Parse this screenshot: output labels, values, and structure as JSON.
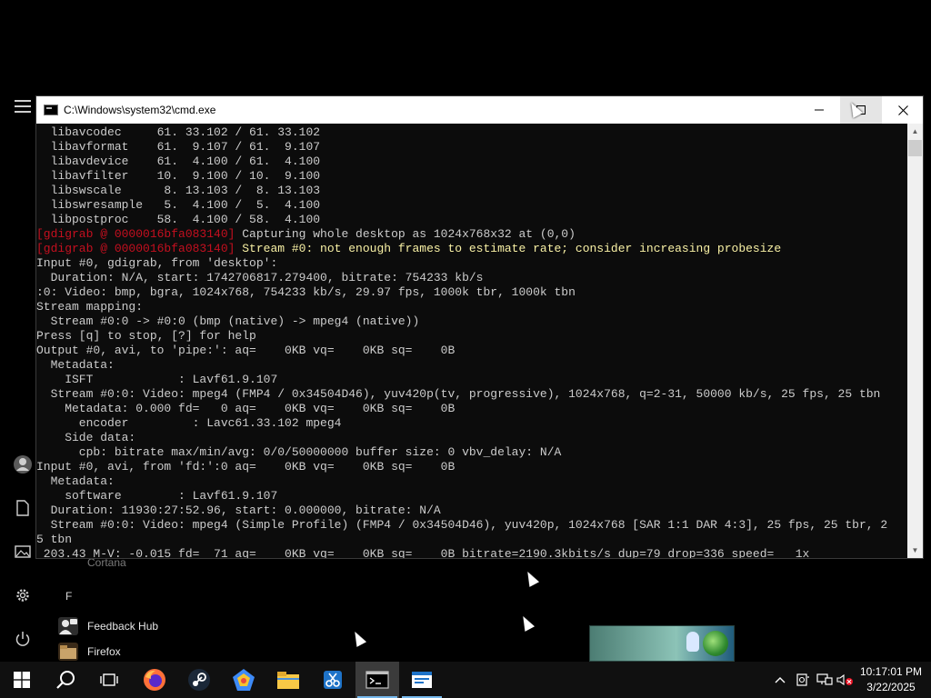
{
  "window": {
    "title": "C:\\Windows\\system32\\cmd.exe",
    "minimize_glyph": "—",
    "maximize_glyph": "☐",
    "close_glyph": "✕"
  },
  "console_lines": [
    {
      "text": "  libavcodec     61. 33.102 / 61. 33.102"
    },
    {
      "text": "  libavformat    61.  9.107 / 61.  9.107"
    },
    {
      "text": "  libavdevice    61.  4.100 / 61.  4.100"
    },
    {
      "text": "  libavfilter    10.  9.100 / 10.  9.100"
    },
    {
      "text": "  libswscale      8. 13.103 /  8. 13.103"
    },
    {
      "text": "  libswresample   5.  4.100 /  5.  4.100"
    },
    {
      "text": "  libpostproc    58.  4.100 / 58.  4.100"
    },
    {
      "tag": "[gdigrab @ 0000016bfa083140]",
      "text": " Capturing whole desktop as 1024x768x32 at (0,0)"
    },
    {
      "tag": "[gdigrab @ 0000016bfa083140]",
      "warn": " Stream #0: not enough frames to estimate rate; consider increasing probesize"
    },
    {
      "text": "Input #0, gdigrab, from 'desktop':"
    },
    {
      "text": "  Duration: N/A, start: 1742706817.279400, bitrate: 754233 kb/s"
    },
    {
      "text": ":0: Video: bmp, bgra, 1024x768, 754233 kb/s, 29.97 fps, 1000k tbr, 1000k tbn"
    },
    {
      "text": "Stream mapping:"
    },
    {
      "text": "  Stream #0:0 -> #0:0 (bmp (native) -> mpeg4 (native))"
    },
    {
      "text": "Press [q] to stop, [?] for help"
    },
    {
      "text": "Output #0, avi, to 'pipe:': aq=    0KB vq=    0KB sq=    0B"
    },
    {
      "text": "  Metadata:"
    },
    {
      "text": "    ISFT            : Lavf61.9.107"
    },
    {
      "text": "  Stream #0:0: Video: mpeg4 (FMP4 / 0x34504D46), yuv420p(tv, progressive), 1024x768, q=2-31, 50000 kb/s, 25 fps, 25 tbn"
    },
    {
      "text": "    Metadata: 0.000 fd=   0 aq=    0KB vq=    0KB sq=    0B"
    },
    {
      "text": "      encoder         : Lavc61.33.102 mpeg4"
    },
    {
      "text": "    Side data:"
    },
    {
      "text": "      cpb: bitrate max/min/avg: 0/0/50000000 buffer size: 0 vbv_delay: N/A"
    },
    {
      "text": "Input #0, avi, from 'fd:':0 aq=    0KB vq=    0KB sq=    0B"
    },
    {
      "text": "  Metadata:"
    },
    {
      "text": "    software        : Lavf61.9.107"
    },
    {
      "text": "  Duration: 11930:27:52.96, start: 0.000000, bitrate: N/A"
    },
    {
      "text": "  Stream #0:0: Video: mpeg4 (Simple Profile) (FMP4 / 0x34504D46), yuv420p, 1024x768 [SAR 1:1 DAR 4:3], 25 fps, 25 tbr, 2"
    },
    {
      "text": "5 tbn"
    },
    {
      "text": " 203.43 M-V: -0.015 fd=  71 aq=    0KB vq=    0KB sq=    0B bitrate=2190.3kbits/s dup=79 drop=336 speed=   1x"
    }
  ],
  "start_menu": {
    "cortana_label": "Cortana",
    "section_letter": "F",
    "apps": [
      {
        "label": "Feedback Hub"
      },
      {
        "label": "Firefox"
      }
    ]
  },
  "taskbar": {
    "time": "10:17:01 PM",
    "date": "3/22/2025",
    "buttons": [
      "start",
      "search",
      "task-view",
      "firefox",
      "steam",
      "app",
      "file-explorer",
      "snip",
      "command-prompt",
      "window"
    ]
  },
  "colors": {
    "console_bg": "#0c0c0c",
    "console_fg": "#cccccc",
    "tag_red": "#c50f1f",
    "warn_yellow": "#f9f1a5",
    "taskbar_bg": "#101010",
    "accent": "#76b9ed"
  }
}
